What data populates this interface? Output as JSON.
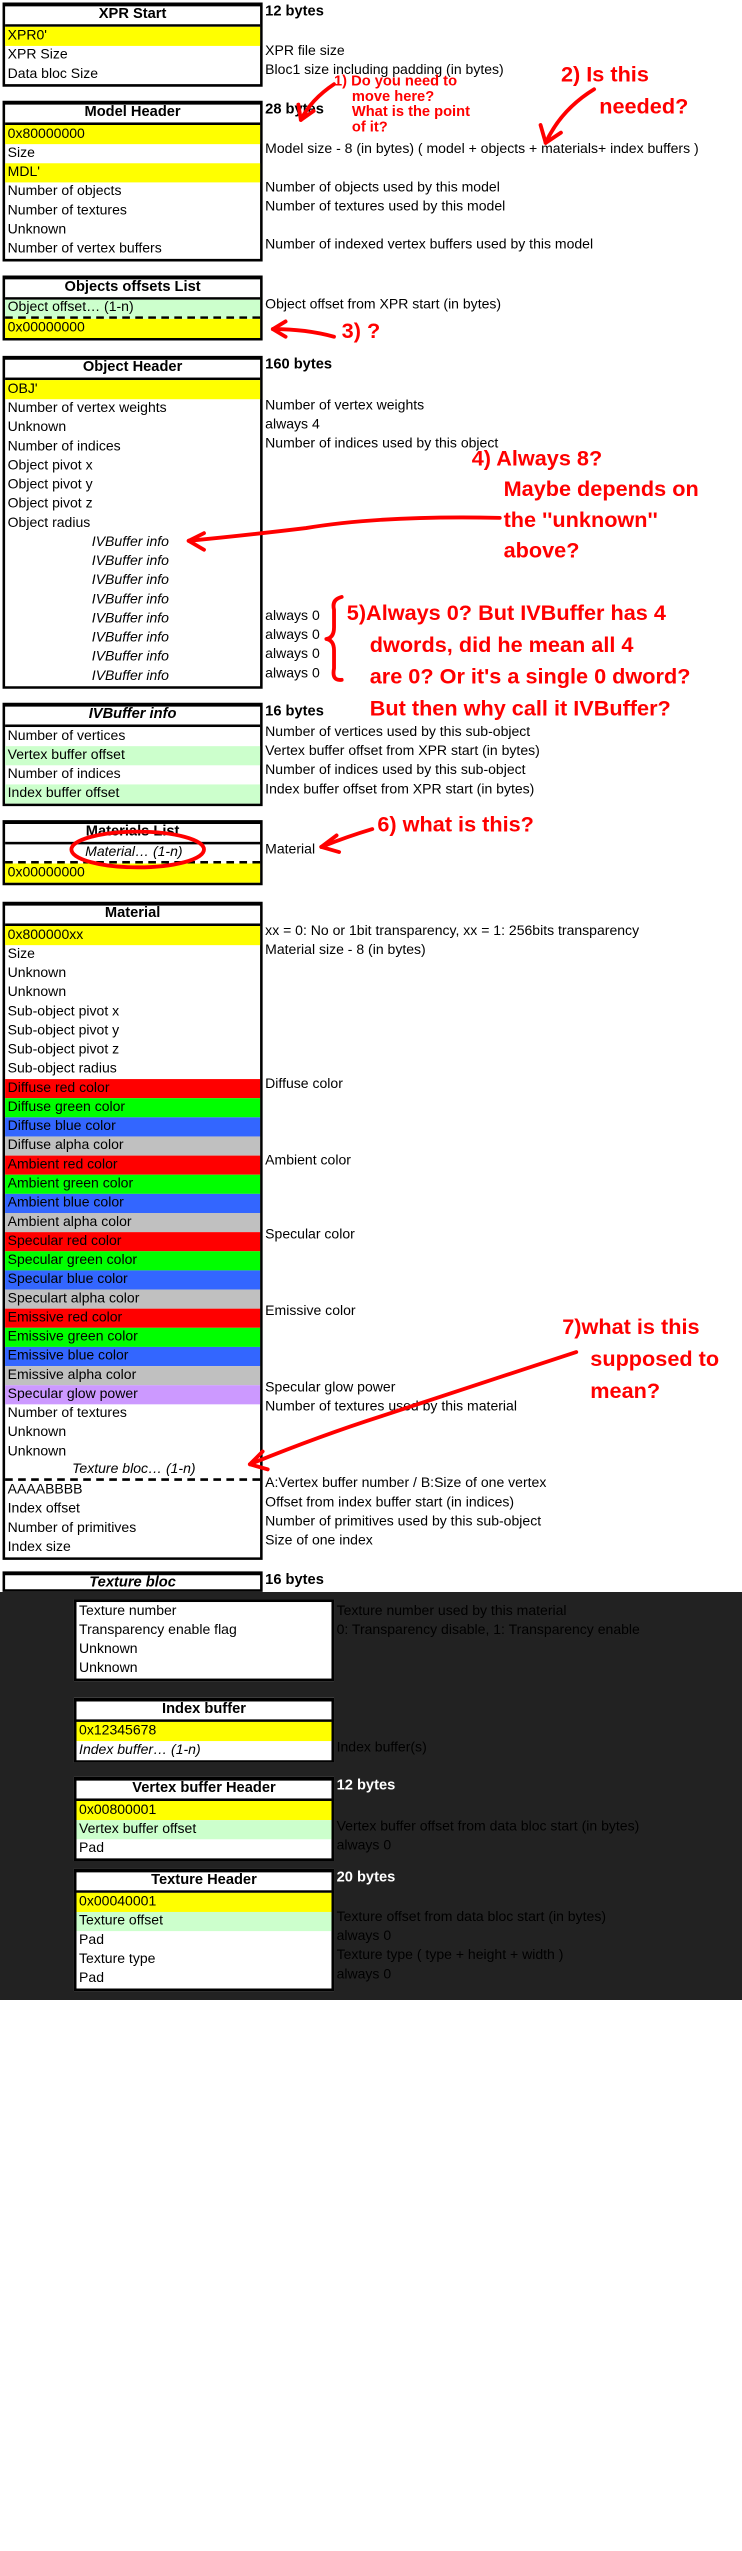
{
  "xpr_start": {
    "title": "XPR Start",
    "size": "12 bytes",
    "rows": [
      {
        "label": "XPR0'",
        "desc": ""
      },
      {
        "label": "XPR Size",
        "desc": "XPR file size"
      },
      {
        "label": "Data bloc Size",
        "desc": "Bloc1 size including padding (in bytes)"
      }
    ]
  },
  "model_header": {
    "title": "Model Header",
    "size": "28 bytes",
    "rows": [
      {
        "label": "0x80000000",
        "desc": ""
      },
      {
        "label": "Size",
        "desc": "Model size - 8 (in bytes) ( model + objects + materials+ index buffers )"
      },
      {
        "label": "MDL'",
        "desc": ""
      },
      {
        "label": "Number of objects",
        "desc": "Number of objects used by this model"
      },
      {
        "label": "Number of textures",
        "desc": "Number of textures used by this model"
      },
      {
        "label": "Unknown",
        "desc": ""
      },
      {
        "label": "Number of vertex buffers",
        "desc": "Number of indexed vertex buffers used by this model"
      }
    ]
  },
  "objects_offsets": {
    "title": "Objects offsets List",
    "rows": [
      {
        "label": "Object offset… (1-n)",
        "desc": "Object offset from XPR start (in bytes)"
      },
      {
        "label": "0x00000000",
        "desc": ""
      }
    ]
  },
  "object_header": {
    "title": "Object Header",
    "size": "160 bytes",
    "rows": [
      {
        "label": "OBJ'",
        "desc": ""
      },
      {
        "label": "Number of vertex weights",
        "desc": "Number of vertex weights"
      },
      {
        "label": "Unknown",
        "desc": "always 4"
      },
      {
        "label": "Number of indices",
        "desc": "Number of indices used by this object"
      },
      {
        "label": "Object pivot x",
        "desc": ""
      },
      {
        "label": "Object pivot y",
        "desc": ""
      },
      {
        "label": "Object pivot z",
        "desc": ""
      },
      {
        "label": "Object radius",
        "desc": ""
      },
      {
        "label": "IVBuffer info",
        "desc": ""
      },
      {
        "label": "IVBuffer info",
        "desc": ""
      },
      {
        "label": "IVBuffer info",
        "desc": ""
      },
      {
        "label": "IVBuffer info",
        "desc": ""
      },
      {
        "label": "IVBuffer info",
        "desc": "always 0"
      },
      {
        "label": "IVBuffer info",
        "desc": "always 0"
      },
      {
        "label": "IVBuffer info",
        "desc": "always 0"
      },
      {
        "label": "IVBuffer info",
        "desc": "always 0"
      }
    ]
  },
  "ivbuffer_info": {
    "title": "IVBuffer info",
    "size": "16 bytes",
    "rows": [
      {
        "label": "Number of vertices",
        "desc": "Number of vertices used by this sub-object"
      },
      {
        "label": "Vertex buffer offset",
        "desc": "Vertex buffer offset from XPR start (in bytes)"
      },
      {
        "label": "Number of indices",
        "desc": "Number of indices used by this sub-object"
      },
      {
        "label": "Index buffer offset",
        "desc": "Index buffer offset from XPR start (in bytes)"
      }
    ]
  },
  "materials_list": {
    "title": "Materials List",
    "rows": [
      {
        "label": "Material… (1-n)",
        "desc": "Material"
      },
      {
        "label": "0x00000000",
        "desc": ""
      }
    ]
  },
  "material": {
    "title": "Material",
    "rows": [
      {
        "label": "0x800000xx",
        "desc": "xx = 0: No or 1bit transparency, xx = 1: 256bits transparency"
      },
      {
        "label": "Size",
        "desc": "Material size - 8 (in bytes)"
      },
      {
        "label": "Unknown",
        "desc": ""
      },
      {
        "label": "Unknown",
        "desc": ""
      },
      {
        "label": "Sub-object pivot x",
        "desc": ""
      },
      {
        "label": "Sub-object pivot y",
        "desc": ""
      },
      {
        "label": "Sub-object pivot z",
        "desc": ""
      },
      {
        "label": "Sub-object radius",
        "desc": ""
      },
      {
        "label": "Diffuse red color",
        "desc": "Diffuse color"
      },
      {
        "label": "Diffuse green color",
        "desc": ""
      },
      {
        "label": "Diffuse blue color",
        "desc": ""
      },
      {
        "label": "Diffuse alpha color",
        "desc": ""
      },
      {
        "label": "Ambient red color",
        "desc": "Ambient color"
      },
      {
        "label": "Ambient green color",
        "desc": ""
      },
      {
        "label": "Ambient blue color",
        "desc": ""
      },
      {
        "label": "Ambient alpha color",
        "desc": ""
      },
      {
        "label": "Specular red color",
        "desc": "Specular color"
      },
      {
        "label": "Specular green color",
        "desc": ""
      },
      {
        "label": "Specular blue color",
        "desc": ""
      },
      {
        "label": "Speculart alpha color",
        "desc": ""
      },
      {
        "label": "Emissive red color",
        "desc": "Emissive color"
      },
      {
        "label": "Emissive green color",
        "desc": ""
      },
      {
        "label": "Emissive blue color",
        "desc": ""
      },
      {
        "label": "Emissive alpha color",
        "desc": ""
      },
      {
        "label": "Specular glow power",
        "desc": "Specular glow power"
      },
      {
        "label": "Number of textures",
        "desc": "Number of textures used by this material"
      },
      {
        "label": "Unknown",
        "desc": ""
      },
      {
        "label": "Unknown",
        "desc": ""
      },
      {
        "label": "Texture bloc… (1-n)",
        "desc": ""
      },
      {
        "label": "AAAABBBB",
        "desc": "A:Vertex buffer number / B:Size of one vertex"
      },
      {
        "label": "Index offset",
        "desc": "Offset from index buffer start (in indices)"
      },
      {
        "label": "Number of primitives",
        "desc": "Number of primitives used by this sub-object"
      },
      {
        "label": "Index size",
        "desc": "Size of one index"
      }
    ]
  },
  "texture_bloc": {
    "title": "Texture bloc",
    "size": "16 bytes",
    "rows": [
      {
        "label": "Texture number",
        "desc": "Texture number used by this material"
      },
      {
        "label": "Transparency enable flag",
        "desc": "0: Transparency disable, 1: Transparency enable"
      },
      {
        "label": "Unknown",
        "desc": ""
      },
      {
        "label": "Unknown",
        "desc": ""
      }
    ]
  },
  "index_buffer": {
    "title": "Index buffer",
    "rows": [
      {
        "label": "0x12345678",
        "desc": ""
      },
      {
        "label": "Index buffer… (1-n)",
        "desc": "Index buffer(s)"
      }
    ]
  },
  "vertex_buffer_header": {
    "title": "Vertex buffer Header",
    "size": "12 bytes",
    "rows": [
      {
        "label": "0x00800001",
        "desc": ""
      },
      {
        "label": "Vertex buffer offset",
        "desc": "Vertex buffer offset from data bloc start (in bytes)"
      },
      {
        "label": "Pad",
        "desc": "always 0"
      }
    ]
  },
  "texture_header": {
    "title": "Texture Header",
    "size": "20 bytes",
    "rows": [
      {
        "label": "0x00040001",
        "desc": ""
      },
      {
        "label": "Texture offset",
        "desc": "Texture offset from data bloc start (in bytes)"
      },
      {
        "label": "Pad",
        "desc": "always 0"
      },
      {
        "label": "Texture type",
        "desc": "Texture type ( type + height + width )"
      },
      {
        "label": "Pad",
        "desc": "always 0"
      }
    ]
  },
  "annotations": {
    "note1": [
      "1) Do you need to",
      "move here?",
      "What is the point",
      "of it?"
    ],
    "note2": [
      "2) Is this",
      "needed?"
    ],
    "note3": "3) ?",
    "note4": [
      "4) Always 8?",
      "Maybe depends on",
      "the ''unknown''",
      "above?"
    ],
    "note5": [
      "5)Always 0? But IVBuffer has 4",
      "dwords, did he mean all 4",
      "are 0? Or it's a single 0 dword?",
      "But then why call it IVBuffer?"
    ],
    "note6": "6)  what is this?",
    "note7": [
      "7)what is this",
      "supposed to",
      "mean?"
    ],
    "color": "#ff0000"
  }
}
